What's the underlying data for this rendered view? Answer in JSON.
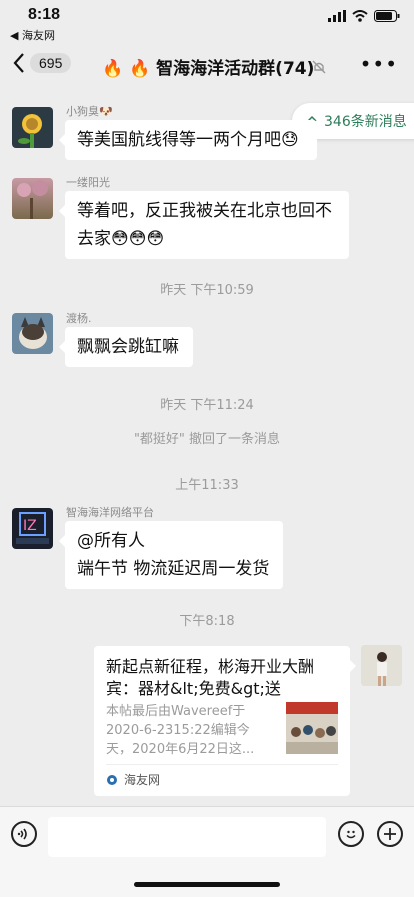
{
  "status_bar": {
    "time": "8:18",
    "back_app": "◀ 海友网"
  },
  "header": {
    "back_count": "695",
    "title": "🔥 🔥 智海海洋活动群(74)",
    "more": "•••"
  },
  "new_messages": "346条新消息",
  "messages": [
    {
      "sender": "小狗臭🐶",
      "text": "等美国航线得等一两个月吧😓"
    },
    {
      "sender": "一缕阳光",
      "line1": "等着吧，反正我被关在北京也回不",
      "line2": "去家😳😳😳"
    },
    {
      "time": "昨天 下午10:59"
    },
    {
      "sender": "渡杨.",
      "text": "飘飘会跳缸嘛"
    },
    {
      "time": "昨天 下午11:24"
    },
    {
      "recall": "\"都挺好\" 撤回了一条消息"
    },
    {
      "time": "上午11:33"
    },
    {
      "sender": "智海海洋网络平台",
      "line1": "@所有人",
      "line2": "端午节 物流延迟周一发货"
    },
    {
      "time": "下午8:18"
    }
  ],
  "link_card": {
    "title_line1": "新起点新征程，彬海开业大酬",
    "title_line2": "宾：器材&lt;免费&gt;送",
    "desc_line1": "本帖最后由Wavereef于",
    "desc_line2": "2020-6-2315:22编辑今",
    "desc_line3": "天，2020年6月22日这...",
    "source": "海友网"
  },
  "colors": {
    "accent": "#2e7d5b",
    "bg": "#ededed"
  }
}
